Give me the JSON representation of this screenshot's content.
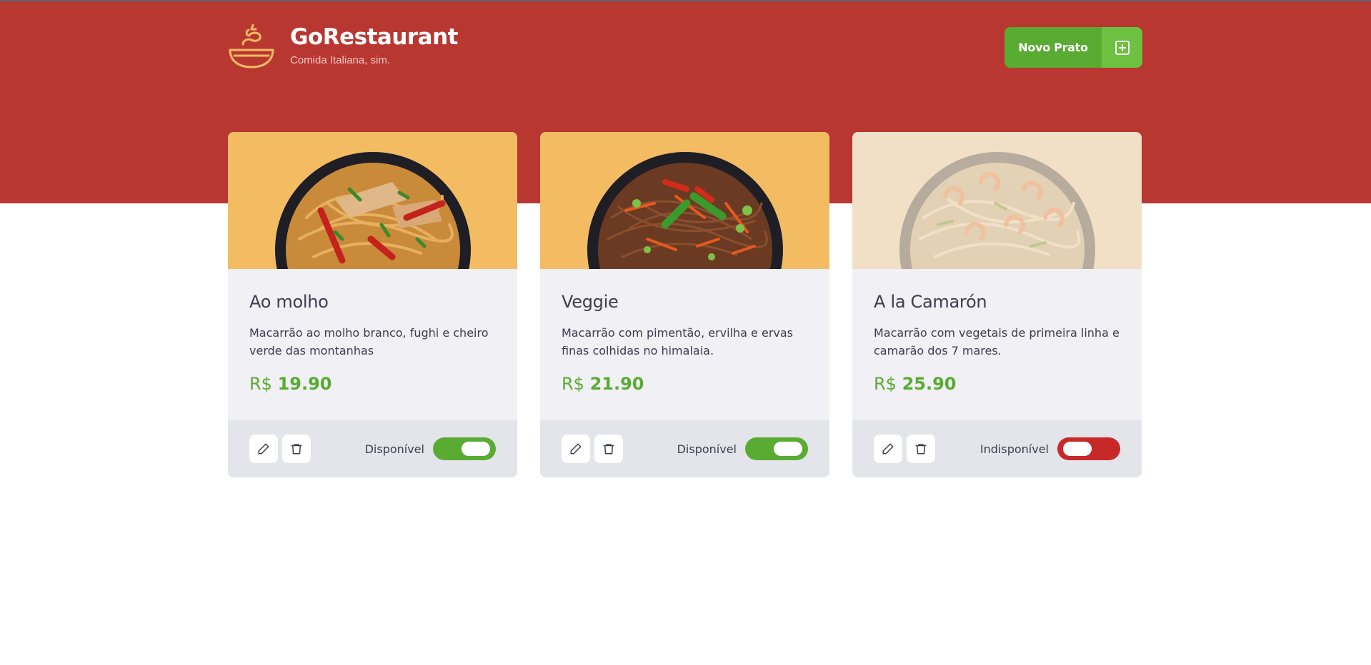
{
  "header": {
    "title": "GoRestaurant",
    "subtitle": "Comida Italiana, sim.",
    "new_button_label": "Novo Prato",
    "logo_icon": "bowl-icon",
    "add_icon": "plus-square-icon"
  },
  "colors": {
    "header_bg": "#b93731",
    "accent_green": "#5aab32",
    "accent_green_light": "#6cc140",
    "price_green": "#5aab32",
    "toggle_off_red": "#c72828",
    "logo_orange": "#f4bc62"
  },
  "foods": [
    {
      "name": "Ao molho",
      "description": "Macarrão ao molho branco, fughi e cheiro verde das montanhas",
      "currency": "R$",
      "price": "19.90",
      "availability_label": "Disponível",
      "available": true
    },
    {
      "name": "Veggie",
      "description": "Macarrão com pimentão, ervilha e ervas finas colhidas no himalaia.",
      "currency": "R$",
      "price": "21.90",
      "availability_label": "Disponível",
      "available": true
    },
    {
      "name": "A la Camarón",
      "description": "Macarrão com vegetais de primeira linha e camarão dos 7 mares.",
      "currency": "R$",
      "price": "25.90",
      "availability_label": "Indisponível",
      "available": false
    }
  ],
  "card_actions": {
    "edit_icon": "pencil-icon",
    "delete_icon": "trash-icon"
  }
}
